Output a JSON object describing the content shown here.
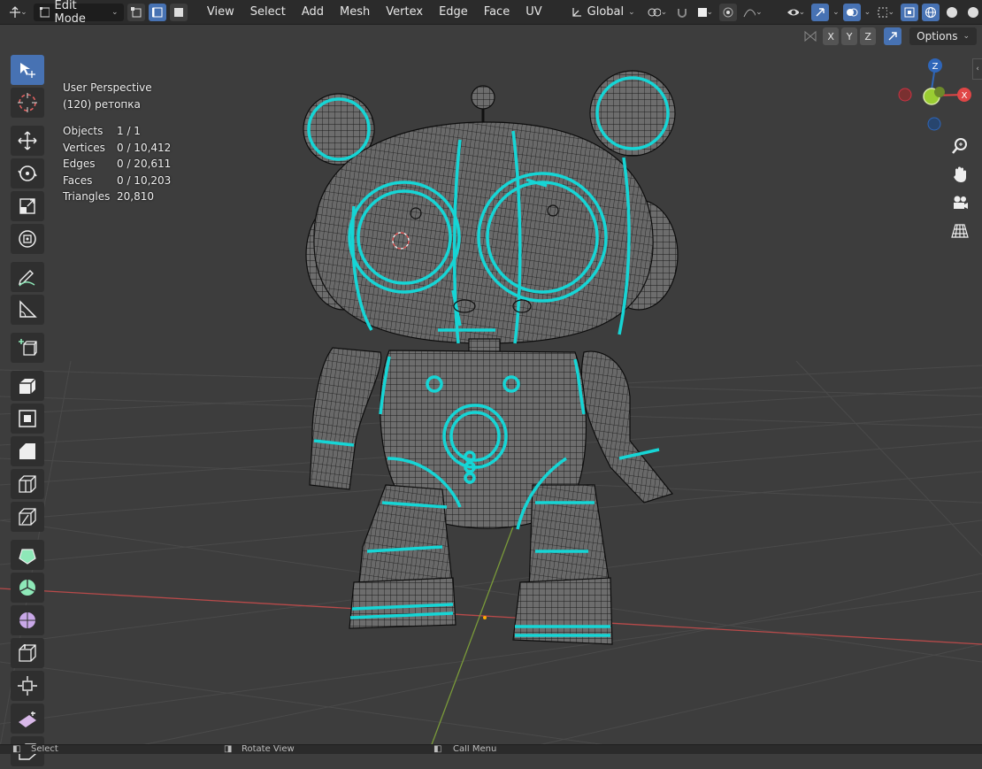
{
  "header": {
    "mode_label": "Edit Mode",
    "menus": [
      "View",
      "Select",
      "Add",
      "Mesh",
      "Vertex",
      "Edge",
      "Face",
      "UV"
    ],
    "orientation_label": "Global"
  },
  "second_row": {
    "axis_x": "X",
    "axis_y": "Y",
    "axis_z": "Z",
    "options_label": "Options"
  },
  "overlay_info": {
    "view_name": "User Perspective",
    "object_name": "(120) ретопка",
    "stats": [
      {
        "label": "Objects",
        "value": "1 / 1"
      },
      {
        "label": "Vertices",
        "value": "0 / 10,412"
      },
      {
        "label": "Edges",
        "value": "0 / 20,611"
      },
      {
        "label": "Faces",
        "value": "0 / 10,203"
      },
      {
        "label": "Triangles",
        "value": "20,810"
      }
    ]
  },
  "gizmo": {
    "z_label": "Z",
    "x_label": "X"
  },
  "statusbar": {
    "select": "Select",
    "rotate": "Rotate View",
    "call": "Call Menu"
  },
  "colors": {
    "accent": "#4772b3",
    "seam": "#16d5d5",
    "wire": "#111111"
  }
}
